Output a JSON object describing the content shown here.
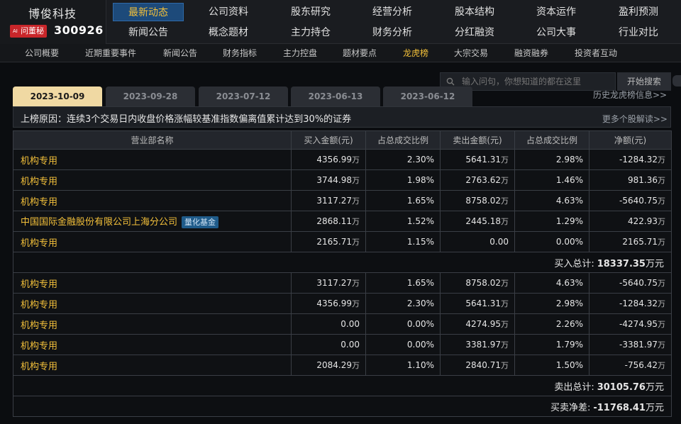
{
  "header": {
    "company_name": "博俊科技",
    "ask_badge": "问董秘",
    "ask_badge_prefix": "AI",
    "stock_code": "300926"
  },
  "nav": {
    "row1": [
      "最新动态",
      "公司资料",
      "股东研究",
      "经营分析",
      "股本结构",
      "资本运作",
      "盈利预测"
    ],
    "row2": [
      "新闻公告",
      "概念题材",
      "主力持仓",
      "财务分析",
      "分红融资",
      "公司大事",
      "行业对比"
    ]
  },
  "subnav": [
    "公司概要",
    "近期重要事件",
    "新闻公告",
    "财务指标",
    "主力控盘",
    "题材要点",
    "龙虎榜",
    "大宗交易",
    "融资融券",
    "投资者互动"
  ],
  "search": {
    "placeholder": "输入问句，你想知道的都在这里",
    "button": "开始搜索"
  },
  "tabs": [
    "2023-10-09",
    "2023-09-28",
    "2023-07-12",
    "2023-06-13",
    "2023-06-12"
  ],
  "history_link": "历史龙虎榜信息>>",
  "reason": {
    "label": "上榜原因：",
    "text": "连续3个交易日内收盘价格涨幅较基准指数偏离值累计达到30%的证券",
    "more": "更多个股解读>>"
  },
  "table": {
    "headers": [
      "营业部名称",
      "买入金额(元)",
      "占总成交比例",
      "卖出金额(元)",
      "占总成交比例",
      "净额(元)"
    ],
    "buy_rows": [
      {
        "name": "机构专用",
        "tag": "",
        "buy": "4356.99",
        "buy_unit": "万",
        "buy_pct": "2.30%",
        "sell": "5641.31",
        "sell_unit": "万",
        "sell_pct": "2.98%",
        "net": "-1284.32",
        "net_unit": "万"
      },
      {
        "name": "机构专用",
        "tag": "",
        "buy": "3744.98",
        "buy_unit": "万",
        "buy_pct": "1.98%",
        "sell": "2763.62",
        "sell_unit": "万",
        "sell_pct": "1.46%",
        "net": "981.36",
        "net_unit": "万"
      },
      {
        "name": "机构专用",
        "tag": "",
        "buy": "3117.27",
        "buy_unit": "万",
        "buy_pct": "1.65%",
        "sell": "8758.02",
        "sell_unit": "万",
        "sell_pct": "4.63%",
        "net": "-5640.75",
        "net_unit": "万"
      },
      {
        "name": "中国国际金融股份有限公司上海分公司",
        "tag": "量化基金",
        "buy": "2868.11",
        "buy_unit": "万",
        "buy_pct": "1.52%",
        "sell": "2445.18",
        "sell_unit": "万",
        "sell_pct": "1.29%",
        "net": "422.93",
        "net_unit": "万"
      },
      {
        "name": "机构专用",
        "tag": "",
        "buy": "2165.71",
        "buy_unit": "万",
        "buy_pct": "1.15%",
        "sell": "0.00",
        "sell_unit": "",
        "sell_pct": "0.00%",
        "net": "2165.71",
        "net_unit": "万"
      }
    ],
    "buy_total": {
      "label": "买入总计:",
      "value": "18337.35",
      "unit": "万元"
    },
    "sell_rows": [
      {
        "name": "机构专用",
        "tag": "",
        "buy": "3117.27",
        "buy_unit": "万",
        "buy_pct": "1.65%",
        "sell": "8758.02",
        "sell_unit": "万",
        "sell_pct": "4.63%",
        "net": "-5640.75",
        "net_unit": "万"
      },
      {
        "name": "机构专用",
        "tag": "",
        "buy": "4356.99",
        "buy_unit": "万",
        "buy_pct": "2.30%",
        "sell": "5641.31",
        "sell_unit": "万",
        "sell_pct": "2.98%",
        "net": "-1284.32",
        "net_unit": "万"
      },
      {
        "name": "机构专用",
        "tag": "",
        "buy": "0.00",
        "buy_unit": "",
        "buy_pct": "0.00%",
        "sell": "4274.95",
        "sell_unit": "万",
        "sell_pct": "2.26%",
        "net": "-4274.95",
        "net_unit": "万"
      },
      {
        "name": "机构专用",
        "tag": "",
        "buy": "0.00",
        "buy_unit": "",
        "buy_pct": "0.00%",
        "sell": "3381.97",
        "sell_unit": "万",
        "sell_pct": "1.79%",
        "net": "-3381.97",
        "net_unit": "万"
      },
      {
        "name": "机构专用",
        "tag": "",
        "buy": "2084.29",
        "buy_unit": "万",
        "buy_pct": "1.10%",
        "sell": "2840.71",
        "sell_unit": "万",
        "sell_pct": "1.50%",
        "net": "-756.42",
        "net_unit": "万"
      }
    ],
    "sell_total": {
      "label": "卖出总计:",
      "value": "30105.76",
      "unit": "万元"
    },
    "net_total": {
      "label": "买卖净差:",
      "value": "-11768.41",
      "unit": "万元"
    }
  },
  "colors": {
    "accent_gold": "#f3c03a",
    "active_tab": "#f0d9a3",
    "nav_active": "#1d4a7a",
    "badge_red": "#c8262a",
    "quant_tag": "#1f5b8a"
  }
}
